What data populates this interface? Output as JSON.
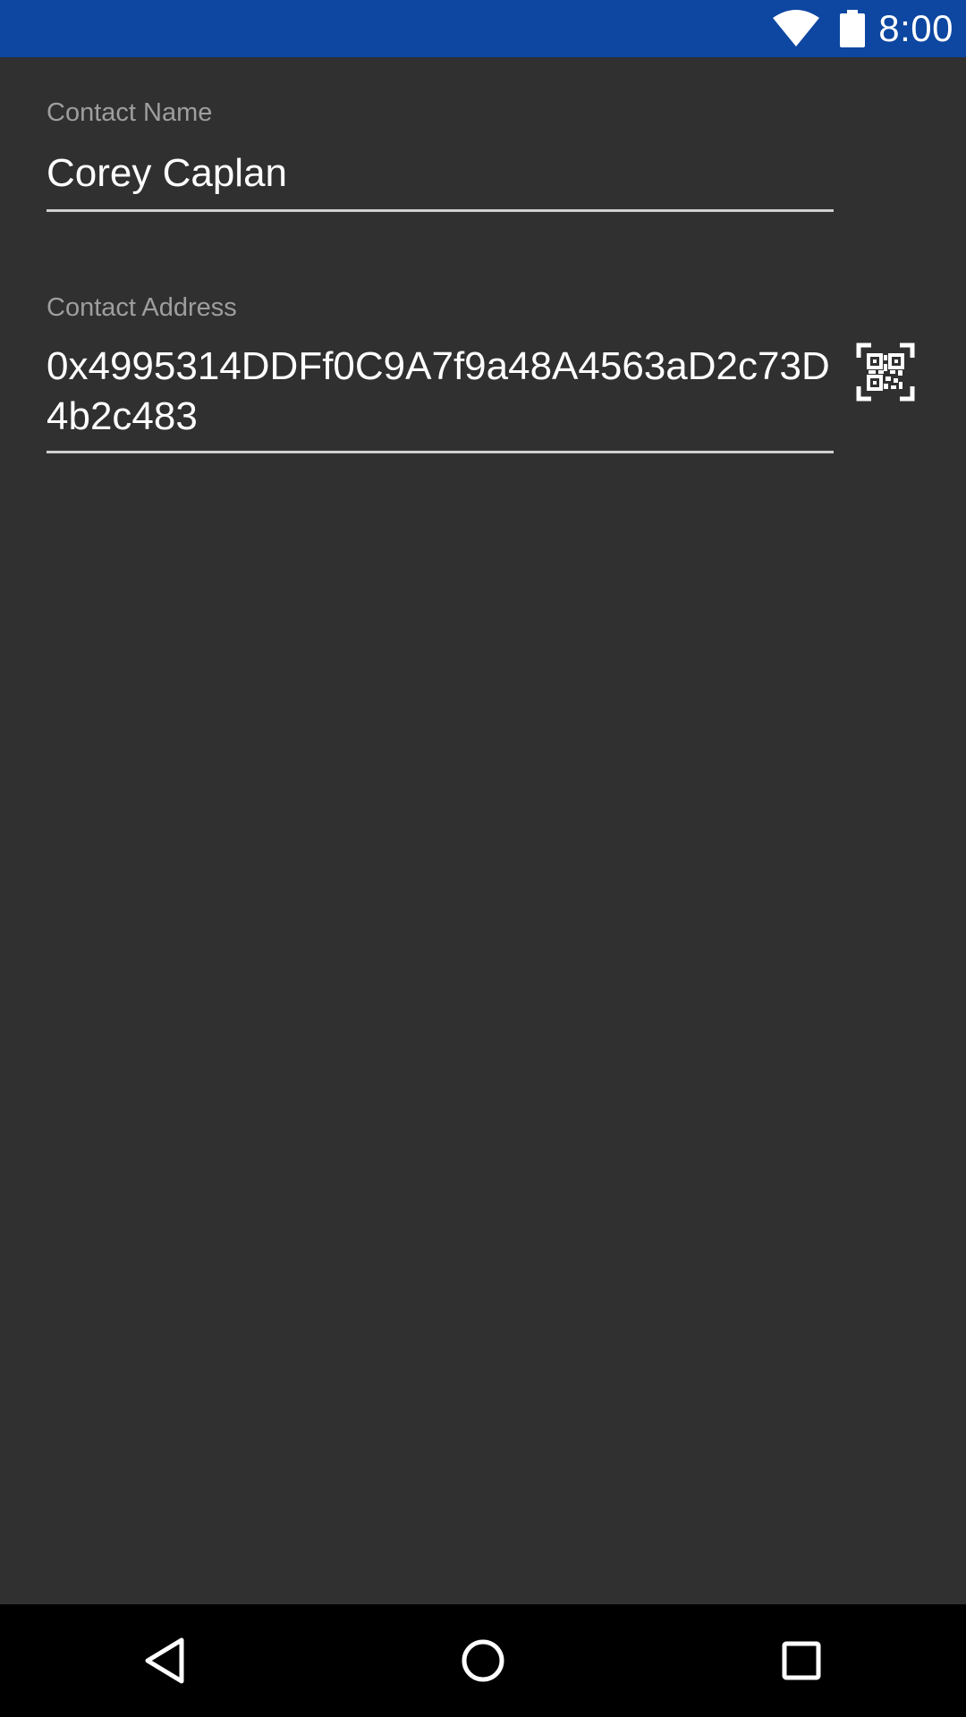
{
  "status_bar": {
    "time": "8:00",
    "wifi_icon": "wifi-icon",
    "battery_icon": "battery-icon",
    "background_color": "#0d47a1"
  },
  "form": {
    "name_field": {
      "label": "Contact Name",
      "value": "Corey Caplan"
    },
    "address_field": {
      "label": "Contact Address",
      "value": "0x4995314DDFf0C9A7f9a48A4563aD2c73D4b2c483",
      "scan_icon": "qr-code-scan-icon"
    }
  },
  "nav_bar": {
    "back_icon": "back-icon",
    "home_icon": "home-icon",
    "recents_icon": "recents-icon"
  },
  "theme": {
    "background": "#303030",
    "label_color": "#9e9e9e",
    "text_color": "#ffffff"
  }
}
